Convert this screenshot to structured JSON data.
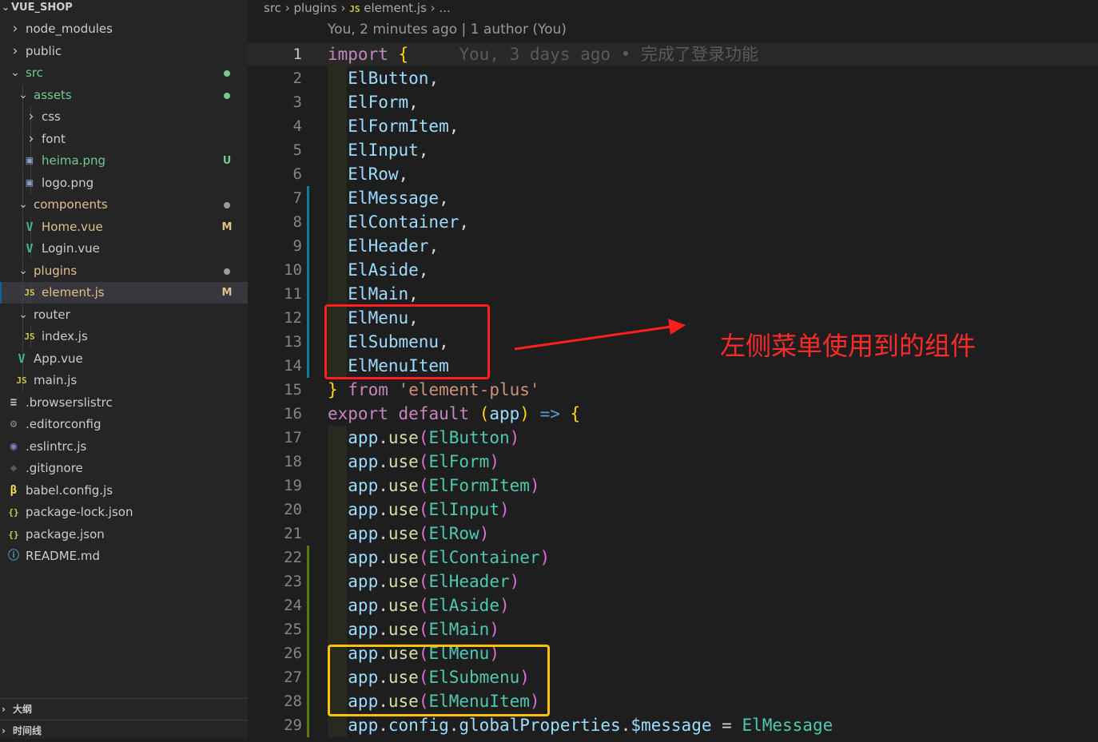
{
  "explorer": {
    "root": "VUE_SHOP",
    "items": [
      {
        "label": "node_modules",
        "kind": "folder",
        "expanded": false,
        "depth": 1,
        "icon": "",
        "color": "#cccccc",
        "badge": "",
        "dot": ""
      },
      {
        "label": "public",
        "kind": "folder",
        "expanded": false,
        "depth": 1,
        "icon": "",
        "color": "#cccccc",
        "badge": "",
        "dot": ""
      },
      {
        "label": "src",
        "kind": "folder",
        "expanded": true,
        "depth": 1,
        "icon": "",
        "color": "#73c991",
        "badge": "",
        "dot": "#73c991"
      },
      {
        "label": "assets",
        "kind": "folder",
        "expanded": true,
        "depth": 2,
        "icon": "",
        "color": "#73c991",
        "badge": "",
        "dot": "#73c991"
      },
      {
        "label": "css",
        "kind": "folder",
        "expanded": false,
        "depth": 3,
        "icon": "",
        "color": "#cccccc",
        "badge": "",
        "dot": ""
      },
      {
        "label": "font",
        "kind": "folder",
        "expanded": false,
        "depth": 3,
        "icon": "",
        "color": "#cccccc",
        "badge": "",
        "dot": ""
      },
      {
        "label": "heima.png",
        "kind": "file",
        "depth": 3,
        "icon": "image-icon",
        "color": "#73c991",
        "badge": "U",
        "badgeColor": "#73c991",
        "dot": ""
      },
      {
        "label": "logo.png",
        "kind": "file",
        "depth": 3,
        "icon": "image-icon",
        "color": "#cccccc",
        "badge": "",
        "dot": ""
      },
      {
        "label": "components",
        "kind": "folder",
        "expanded": true,
        "depth": 2,
        "icon": "",
        "color": "#e2c08d",
        "badge": "",
        "dot": "#9d9d9d"
      },
      {
        "label": "Home.vue",
        "kind": "file",
        "depth": 3,
        "icon": "vue-icon",
        "color": "#e2c08d",
        "badge": "M",
        "badgeColor": "#e2c08d",
        "dot": ""
      },
      {
        "label": "Login.vue",
        "kind": "file",
        "depth": 3,
        "icon": "vue-icon",
        "color": "#cccccc",
        "badge": "",
        "dot": ""
      },
      {
        "label": "plugins",
        "kind": "folder",
        "expanded": true,
        "depth": 2,
        "icon": "",
        "color": "#e2c08d",
        "badge": "",
        "dot": "#9d9d9d"
      },
      {
        "label": "element.js",
        "kind": "file",
        "depth": 3,
        "icon": "js-icon",
        "color": "#e2c08d",
        "badge": "M",
        "badgeColor": "#e2c08d",
        "dot": "",
        "selected": true
      },
      {
        "label": "router",
        "kind": "folder",
        "expanded": true,
        "depth": 2,
        "icon": "",
        "color": "#cccccc",
        "badge": "",
        "dot": ""
      },
      {
        "label": "index.js",
        "kind": "file",
        "depth": 3,
        "icon": "js-icon",
        "color": "#cccccc",
        "badge": "",
        "dot": ""
      },
      {
        "label": "App.vue",
        "kind": "file",
        "depth": 2,
        "icon": "vue-icon",
        "color": "#cccccc",
        "badge": "",
        "dot": ""
      },
      {
        "label": "main.js",
        "kind": "file",
        "depth": 2,
        "icon": "js-icon",
        "color": "#cccccc",
        "badge": "",
        "dot": ""
      },
      {
        "label": ".browserslistrc",
        "kind": "file",
        "depth": 1,
        "icon": "lines-icon",
        "color": "#cccccc",
        "badge": "",
        "dot": ""
      },
      {
        "label": ".editorconfig",
        "kind": "file",
        "depth": 1,
        "icon": "gear-icon",
        "color": "#cccccc",
        "badge": "",
        "dot": ""
      },
      {
        "label": ".eslintrc.js",
        "kind": "file",
        "depth": 1,
        "icon": "eslint-icon",
        "color": "#cccccc",
        "badge": "",
        "dot": ""
      },
      {
        "label": ".gitignore",
        "kind": "file",
        "depth": 1,
        "icon": "git-icon",
        "color": "#cccccc",
        "badge": "",
        "dot": ""
      },
      {
        "label": "babel.config.js",
        "kind": "file",
        "depth": 1,
        "icon": "babel-icon",
        "color": "#cccccc",
        "badge": "",
        "dot": ""
      },
      {
        "label": "package-lock.json",
        "kind": "file",
        "depth": 1,
        "icon": "json-icon",
        "color": "#cccccc",
        "badge": "",
        "dot": ""
      },
      {
        "label": "package.json",
        "kind": "file",
        "depth": 1,
        "icon": "json-icon",
        "color": "#cccccc",
        "badge": "",
        "dot": ""
      },
      {
        "label": "README.md",
        "kind": "file",
        "depth": 1,
        "icon": "info-icon",
        "color": "#cccccc",
        "badge": "",
        "dot": ""
      }
    ]
  },
  "panels": {
    "outline": "大纲",
    "timeline": "时间线"
  },
  "breadcrumb": {
    "parts": [
      "src",
      "plugins",
      "element.js",
      "..."
    ]
  },
  "codelens": "You, 2 minutes ago | 1 author (You)",
  "blame": "You, 3 days ago • 完成了登录功能",
  "code": [
    {
      "n": "1",
      "tokens": [
        [
          "kw",
          "import"
        ],
        [
          "op",
          " "
        ],
        [
          "br1",
          "{"
        ]
      ]
    },
    {
      "n": "2",
      "tokens": [
        [
          "var",
          "  ElButton"
        ],
        [
          "op",
          ","
        ]
      ]
    },
    {
      "n": "3",
      "tokens": [
        [
          "var",
          "  ElForm"
        ],
        [
          "op",
          ","
        ]
      ]
    },
    {
      "n": "4",
      "tokens": [
        [
          "var",
          "  ElFormItem"
        ],
        [
          "op",
          ","
        ]
      ]
    },
    {
      "n": "5",
      "tokens": [
        [
          "var",
          "  ElInput"
        ],
        [
          "op",
          ","
        ]
      ]
    },
    {
      "n": "6",
      "tokens": [
        [
          "var",
          "  ElRow"
        ],
        [
          "op",
          ","
        ]
      ]
    },
    {
      "n": "7",
      "tokens": [
        [
          "var",
          "  ElMessage"
        ],
        [
          "op",
          ","
        ]
      ]
    },
    {
      "n": "8",
      "tokens": [
        [
          "var",
          "  ElContainer"
        ],
        [
          "op",
          ","
        ]
      ]
    },
    {
      "n": "9",
      "tokens": [
        [
          "var",
          "  ElHeader"
        ],
        [
          "op",
          ","
        ]
      ]
    },
    {
      "n": "10",
      "tokens": [
        [
          "var",
          "  ElAside"
        ],
        [
          "op",
          ","
        ]
      ]
    },
    {
      "n": "11",
      "tokens": [
        [
          "var",
          "  ElMain"
        ],
        [
          "op",
          ","
        ]
      ]
    },
    {
      "n": "12",
      "tokens": [
        [
          "var",
          "  ElMenu"
        ],
        [
          "op",
          ","
        ]
      ]
    },
    {
      "n": "13",
      "tokens": [
        [
          "var",
          "  ElSubmenu"
        ],
        [
          "op",
          ","
        ]
      ]
    },
    {
      "n": "14",
      "tokens": [
        [
          "var",
          "  ElMenuItem"
        ]
      ]
    },
    {
      "n": "15",
      "tokens": [
        [
          "br1",
          "}"
        ],
        [
          "op",
          " "
        ],
        [
          "kw",
          "from"
        ],
        [
          "op",
          " "
        ],
        [
          "str",
          "'element-plus'"
        ]
      ]
    },
    {
      "n": "16",
      "tokens": [
        [
          "kw",
          "export"
        ],
        [
          "op",
          " "
        ],
        [
          "kw",
          "default"
        ],
        [
          "op",
          " "
        ],
        [
          "br1",
          "("
        ],
        [
          "var",
          "app"
        ],
        [
          "br1",
          ")"
        ],
        [
          "op",
          " "
        ],
        [
          "kw2",
          "=>"
        ],
        [
          "op",
          " "
        ],
        [
          "br1",
          "{"
        ]
      ]
    },
    {
      "n": "17",
      "tokens": [
        [
          "var",
          "  app"
        ],
        [
          "op",
          "."
        ],
        [
          "fn",
          "use"
        ],
        [
          "br2",
          "("
        ],
        [
          "cls",
          "ElButton"
        ],
        [
          "br2",
          ")"
        ]
      ]
    },
    {
      "n": "18",
      "tokens": [
        [
          "var",
          "  app"
        ],
        [
          "op",
          "."
        ],
        [
          "fn",
          "use"
        ],
        [
          "br2",
          "("
        ],
        [
          "cls",
          "ElForm"
        ],
        [
          "br2",
          ")"
        ]
      ]
    },
    {
      "n": "19",
      "tokens": [
        [
          "var",
          "  app"
        ],
        [
          "op",
          "."
        ],
        [
          "fn",
          "use"
        ],
        [
          "br2",
          "("
        ],
        [
          "cls",
          "ElFormItem"
        ],
        [
          "br2",
          ")"
        ]
      ]
    },
    {
      "n": "20",
      "tokens": [
        [
          "var",
          "  app"
        ],
        [
          "op",
          "."
        ],
        [
          "fn",
          "use"
        ],
        [
          "br2",
          "("
        ],
        [
          "cls",
          "ElInput"
        ],
        [
          "br2",
          ")"
        ]
      ]
    },
    {
      "n": "21",
      "tokens": [
        [
          "var",
          "  app"
        ],
        [
          "op",
          "."
        ],
        [
          "fn",
          "use"
        ],
        [
          "br2",
          "("
        ],
        [
          "cls",
          "ElRow"
        ],
        [
          "br2",
          ")"
        ]
      ]
    },
    {
      "n": "22",
      "tokens": [
        [
          "var",
          "  app"
        ],
        [
          "op",
          "."
        ],
        [
          "fn",
          "use"
        ],
        [
          "br2",
          "("
        ],
        [
          "cls",
          "ElContainer"
        ],
        [
          "br2",
          ")"
        ]
      ]
    },
    {
      "n": "23",
      "tokens": [
        [
          "var",
          "  app"
        ],
        [
          "op",
          "."
        ],
        [
          "fn",
          "use"
        ],
        [
          "br2",
          "("
        ],
        [
          "cls",
          "ElHeader"
        ],
        [
          "br2",
          ")"
        ]
      ]
    },
    {
      "n": "24",
      "tokens": [
        [
          "var",
          "  app"
        ],
        [
          "op",
          "."
        ],
        [
          "fn",
          "use"
        ],
        [
          "br2",
          "("
        ],
        [
          "cls",
          "ElAside"
        ],
        [
          "br2",
          ")"
        ]
      ]
    },
    {
      "n": "25",
      "tokens": [
        [
          "var",
          "  app"
        ],
        [
          "op",
          "."
        ],
        [
          "fn",
          "use"
        ],
        [
          "br2",
          "("
        ],
        [
          "cls",
          "ElMain"
        ],
        [
          "br2",
          ")"
        ]
      ]
    },
    {
      "n": "26",
      "tokens": [
        [
          "var",
          "  app"
        ],
        [
          "op",
          "."
        ],
        [
          "fn",
          "use"
        ],
        [
          "br2",
          "("
        ],
        [
          "cls",
          "ElMenu"
        ],
        [
          "br2",
          ")"
        ]
      ]
    },
    {
      "n": "27",
      "tokens": [
        [
          "var",
          "  app"
        ],
        [
          "op",
          "."
        ],
        [
          "fn",
          "use"
        ],
        [
          "br2",
          "("
        ],
        [
          "cls",
          "ElSubmenu"
        ],
        [
          "br2",
          ")"
        ]
      ]
    },
    {
      "n": "28",
      "tokens": [
        [
          "var",
          "  app"
        ],
        [
          "op",
          "."
        ],
        [
          "fn",
          "use"
        ],
        [
          "br2",
          "("
        ],
        [
          "cls",
          "ElMenuItem"
        ],
        [
          "br2",
          ")"
        ]
      ]
    },
    {
      "n": "29",
      "tokens": [
        [
          "var",
          "  app"
        ],
        [
          "op",
          "."
        ],
        [
          "var",
          "config"
        ],
        [
          "op",
          "."
        ],
        [
          "var",
          "globalProperties"
        ],
        [
          "op",
          "."
        ],
        [
          "var",
          "$message"
        ],
        [
          "op",
          " = "
        ],
        [
          "cls",
          "ElMessage"
        ]
      ]
    }
  ],
  "gutter": {
    "7": "#0c7d9d",
    "8": "#0c7d9d",
    "9": "#0c7d9d",
    "10": "#0c7d9d",
    "11": "#0c7d9d",
    "12": "#0c7d9d",
    "13": "#0c7d9d",
    "14": "#0c7d9d",
    "22": "#587c0c",
    "23": "#587c0c",
    "24": "#587c0c",
    "25": "#587c0c",
    "26": "#587c0c",
    "27": "#587c0c",
    "28": "#587c0c",
    "29": "#587c0c"
  },
  "annotation": {
    "text": "左侧菜单使用到的组件",
    "color": "#ff2a2a",
    "box_colors": {
      "red": "#ff1e1e",
      "yellow": "#ffc107"
    }
  }
}
